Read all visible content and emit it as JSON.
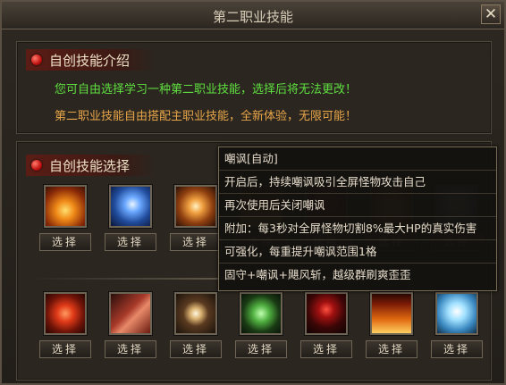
{
  "window": {
    "title": "第二职业技能",
    "close_glyph": "✕"
  },
  "intro": {
    "title": "自创技能介绍",
    "line1": "您可自由选择学习一种第二职业技能，选择后将无法更改！",
    "line2": "第二职业技能自由搭配主职业技能，全新体验，无限可能！",
    "line1_color": "#5fe040",
    "line2_color": "#e8a64a"
  },
  "selection": {
    "title": "自创技能选择",
    "select_label": "选择",
    "row1": [
      {
        "icon": "fire-slash-icon"
      },
      {
        "icon": "lightning-icon"
      },
      {
        "icon": "fire-burst-icon"
      },
      {
        "icon": "skill-icon-4"
      },
      {
        "icon": "skill-icon-5"
      },
      {
        "icon": "skill-icon-6"
      },
      {
        "icon": "skill-icon-7"
      }
    ],
    "row2": [
      {
        "icon": "fire-swirl-icon"
      },
      {
        "icon": "muscle-arm-icon"
      },
      {
        "icon": "eye-icon"
      },
      {
        "icon": "spider-web-icon"
      },
      {
        "icon": "hooded-figure-icon"
      },
      {
        "icon": "flame-wall-icon"
      },
      {
        "icon": "ice-spirit-icon"
      }
    ]
  },
  "tooltip": {
    "lines": [
      "嘲讽[自动]",
      "开启后，持续嘲讽吸引全屏怪物攻击自己",
      "再次使用后关闭嘲讽",
      "附加：每3秒对全屏怪物切割8%最大HP的真实伤害",
      "可强化，每重提升嘲讽范围1格",
      "固守+嘲讽+飓风斩，越级群刷爽歪歪"
    ]
  }
}
